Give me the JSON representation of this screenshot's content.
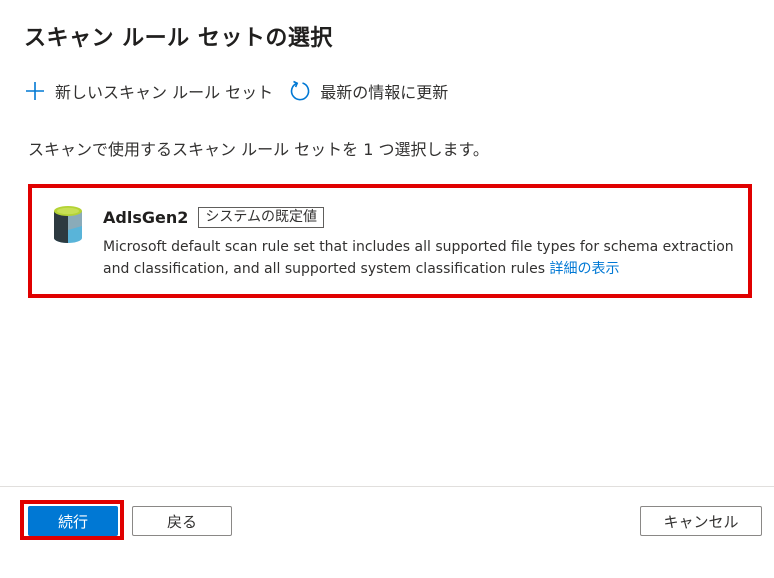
{
  "panel": {
    "title": "スキャン ルール セットの選択"
  },
  "toolbar": {
    "new_label": "新しいスキャン ルール セット",
    "refresh_label": "最新の情報に更新",
    "new_icon": "plus-icon",
    "refresh_icon": "refresh-icon"
  },
  "instructions": "スキャンで使用するスキャン ルール セットを 1 つ選択します。",
  "rule_set": {
    "name": "AdlsGen2",
    "badge": "システムの既定値",
    "description": "Microsoft default scan rule set that includes all supported file types for schema extraction and classification, and all supported system classification rules",
    "details_link": "詳細の表示",
    "icon": "database-icon",
    "highlighted": true
  },
  "footer": {
    "continue_label": "続行",
    "back_label": "戻る",
    "cancel_label": "キャンセル"
  },
  "colors": {
    "accent": "#0078d4",
    "highlight": "#e00000",
    "db_top": "#b4d335",
    "db_body_dark": "#2d3a40",
    "db_body_light": "#59b4d9"
  }
}
